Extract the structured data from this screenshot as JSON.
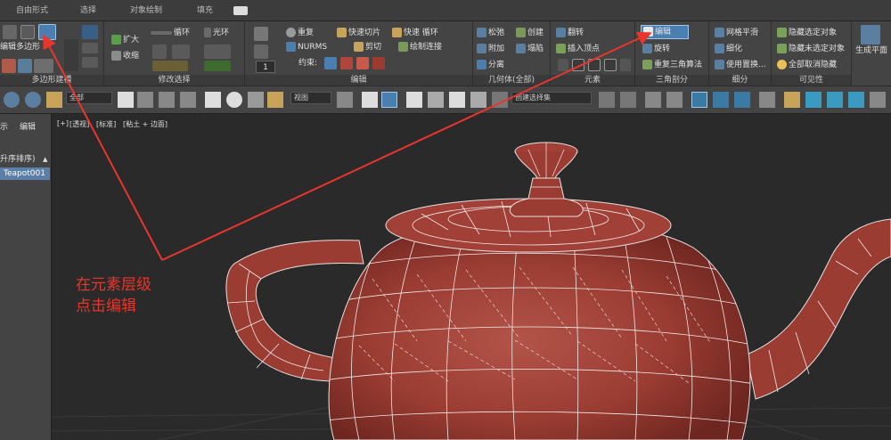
{
  "tabs": [
    "自由形式",
    "选择",
    "对象绘制",
    "填充"
  ],
  "ribbon": {
    "poly": {
      "items": [
        "扩大",
        "收缩",
        "循环",
        "光环"
      ],
      "top_label": "编辑多边形",
      "label": "多边形建模"
    },
    "modsel": {
      "label": "修改选择"
    },
    "edit": {
      "items": [
        "重复",
        "快速切片",
        "快速 循环",
        "NURMS",
        "剪切",
        "绘制连接"
      ],
      "constraint": "约束:",
      "stepper": "1",
      "label": "编辑"
    },
    "geometry": {
      "items": [
        "松弛",
        "创建",
        "附加",
        "塌陷",
        "分离"
      ],
      "label": "几何体(全部)"
    },
    "elements": {
      "items": [
        "翻转",
        "插入顶点"
      ],
      "label": "元素"
    },
    "tri": {
      "items": [
        "编辑",
        "旋转",
        "重复三角算法"
      ],
      "label": "三角剖分"
    },
    "subdiv": {
      "items": [
        "网格平滑",
        "细化",
        "使用置换..."
      ],
      "label": "细分"
    },
    "vis": {
      "items": [
        "隐藏选定对象",
        "隐藏未选定对象",
        "全部取消隐藏"
      ],
      "label": "可见性"
    },
    "plane": {
      "label": "生成平面"
    }
  },
  "toolbar": {
    "filter": "全部",
    "refcoord": "视图",
    "selset": "创建选择集"
  },
  "left_panel": {
    "tab_display": "示",
    "tab_edit": "编辑",
    "sort": "升序排序)",
    "object": "Teapot001"
  },
  "viewport": {
    "labels": [
      "[+]",
      "[透视]",
      "[标准]",
      "[粘土 + 边面]"
    ]
  },
  "annotation": {
    "line1": "在元素层级",
    "line2": "点击编辑"
  },
  "colors": {
    "annotation": "#e8362c",
    "teapot": "#a03c32",
    "highlight": "#4a7fb0"
  }
}
